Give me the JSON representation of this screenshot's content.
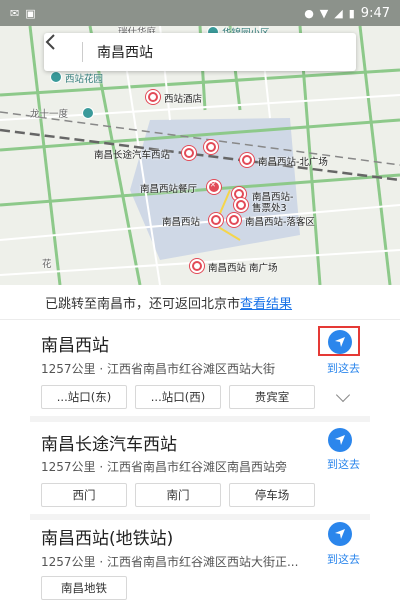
{
  "status_bar": {
    "left_icons": [
      "notification-icon",
      "image-icon"
    ],
    "right_icons": [
      "location-icon",
      "wifi-icon",
      "signal-icon",
      "battery-icon"
    ],
    "time": "9:47"
  },
  "search": {
    "query": "南昌西站"
  },
  "map_labels": {
    "top_road": "瑞仕华庭",
    "top_right": "华锦园小区",
    "xizhan_garden": "西站花园",
    "hotel": "西站酒店",
    "long_tenth_road": "龙十一度",
    "bus_station": "南昌长途汽车西站",
    "north_square": "南昌西站-北广场",
    "restaurant": "南昌西站餐厅",
    "ticket_office_1": "南昌西站-",
    "ticket_office_2": "售票处3",
    "station": "南昌西站",
    "dropoff": "南昌西站-落客区",
    "south_square": "南昌西站 南广场",
    "bottom_left": "花"
  },
  "banner": {
    "text": "已跳转至南昌市，还可返回北京市",
    "link": "查看结果"
  },
  "results": [
    {
      "title": "南昌西站",
      "subtitle": "1257公里 · 江西省南昌市红谷滩区西站大街",
      "nav_label": "到这去",
      "chips": [
        "...站口(东)",
        "...站口(西)",
        "贵宾室"
      ]
    },
    {
      "title": "南昌长途汽车西站",
      "subtitle": "1257公里 · 江西省南昌市红谷滩区南昌西站旁",
      "nav_label": "到这去",
      "chips": [
        "西门",
        "南门",
        "停车场"
      ]
    },
    {
      "title": "南昌西站(地铁站)",
      "subtitle": "1257公里 · 江西省南昌市红谷滩区西站大街正...",
      "nav_label": "到这去",
      "chips": [
        "南昌地铁"
      ]
    }
  ],
  "colors": {
    "accent": "#2b86ec",
    "poi": "#e24a57",
    "highlight": "#e53935",
    "station_area": "#cfd8e6",
    "road_green": "#8dc98a"
  }
}
